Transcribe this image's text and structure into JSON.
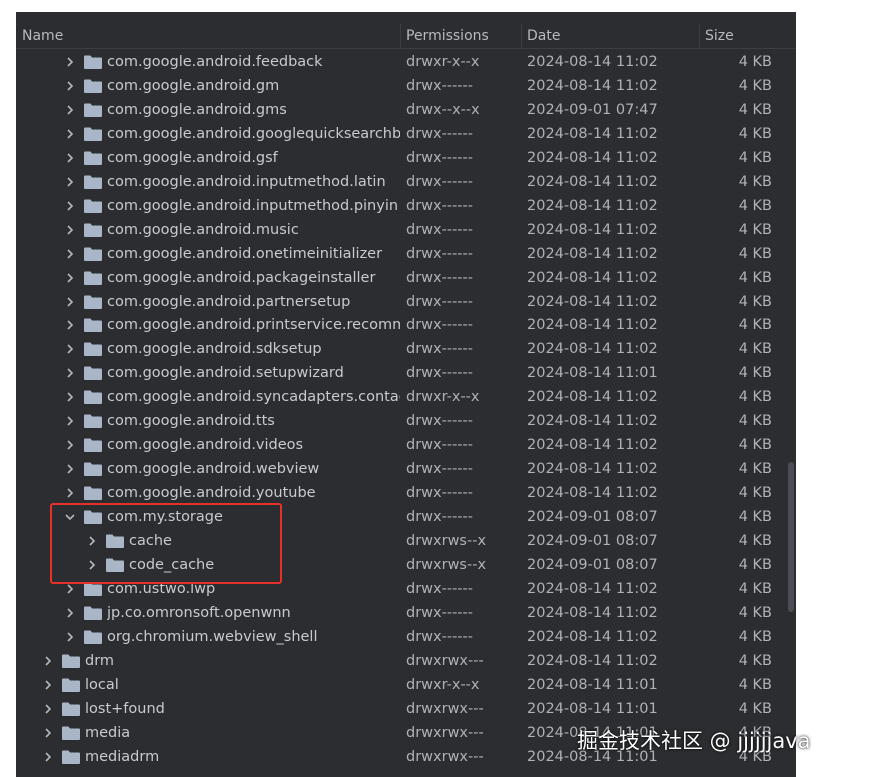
{
  "header": {
    "name": "Name",
    "permissions": "Permissions",
    "date": "Date",
    "size": "Size"
  },
  "icons": {
    "chevron_right": "chevron-right-icon",
    "chevron_down": "chevron-down-icon",
    "folder": "folder-icon"
  },
  "colors": {
    "panel_bg": "#2b2d30",
    "folder": "#a9b6c8",
    "highlight": "#e8302a"
  },
  "rows": [
    {
      "name": "com.google.android.feedback",
      "permissions": "drwxr-x--x",
      "date": "2024-08-14 11:02",
      "size": "4 KB",
      "level": 2,
      "expanded": false
    },
    {
      "name": "com.google.android.gm",
      "permissions": "drwx------",
      "date": "2024-08-14 11:02",
      "size": "4 KB",
      "level": 2,
      "expanded": false
    },
    {
      "name": "com.google.android.gms",
      "permissions": "drwx--x--x",
      "date": "2024-09-01 07:47",
      "size": "4 KB",
      "level": 2,
      "expanded": false
    },
    {
      "name": "com.google.android.googlequicksearchbox",
      "permissions": "drwx------",
      "date": "2024-08-14 11:02",
      "size": "4 KB",
      "level": 2,
      "expanded": false
    },
    {
      "name": "com.google.android.gsf",
      "permissions": "drwx------",
      "date": "2024-08-14 11:02",
      "size": "4 KB",
      "level": 2,
      "expanded": false
    },
    {
      "name": "com.google.android.inputmethod.latin",
      "permissions": "drwx------",
      "date": "2024-08-14 11:02",
      "size": "4 KB",
      "level": 2,
      "expanded": false
    },
    {
      "name": "com.google.android.inputmethod.pinyin",
      "permissions": "drwx------",
      "date": "2024-08-14 11:02",
      "size": "4 KB",
      "level": 2,
      "expanded": false
    },
    {
      "name": "com.google.android.music",
      "permissions": "drwx------",
      "date": "2024-08-14 11:02",
      "size": "4 KB",
      "level": 2,
      "expanded": false
    },
    {
      "name": "com.google.android.onetimeinitializer",
      "permissions": "drwx------",
      "date": "2024-08-14 11:02",
      "size": "4 KB",
      "level": 2,
      "expanded": false
    },
    {
      "name": "com.google.android.packageinstaller",
      "permissions": "drwx------",
      "date": "2024-08-14 11:02",
      "size": "4 KB",
      "level": 2,
      "expanded": false
    },
    {
      "name": "com.google.android.partnersetup",
      "permissions": "drwx------",
      "date": "2024-08-14 11:02",
      "size": "4 KB",
      "level": 2,
      "expanded": false
    },
    {
      "name": "com.google.android.printservice.recommendation",
      "permissions": "drwx------",
      "date": "2024-08-14 11:02",
      "size": "4 KB",
      "level": 2,
      "expanded": false
    },
    {
      "name": "com.google.android.sdksetup",
      "permissions": "drwx------",
      "date": "2024-08-14 11:02",
      "size": "4 KB",
      "level": 2,
      "expanded": false
    },
    {
      "name": "com.google.android.setupwizard",
      "permissions": "drwx------",
      "date": "2024-08-14 11:01",
      "size": "4 KB",
      "level": 2,
      "expanded": false
    },
    {
      "name": "com.google.android.syncadapters.contacts",
      "permissions": "drwxr-x--x",
      "date": "2024-08-14 11:02",
      "size": "4 KB",
      "level": 2,
      "expanded": false
    },
    {
      "name": "com.google.android.tts",
      "permissions": "drwx------",
      "date": "2024-08-14 11:02",
      "size": "4 KB",
      "level": 2,
      "expanded": false
    },
    {
      "name": "com.google.android.videos",
      "permissions": "drwx------",
      "date": "2024-08-14 11:02",
      "size": "4 KB",
      "level": 2,
      "expanded": false
    },
    {
      "name": "com.google.android.webview",
      "permissions": "drwx------",
      "date": "2024-08-14 11:02",
      "size": "4 KB",
      "level": 2,
      "expanded": false
    },
    {
      "name": "com.google.android.youtube",
      "permissions": "drwx------",
      "date": "2024-08-14 11:02",
      "size": "4 KB",
      "level": 2,
      "expanded": false
    },
    {
      "name": "com.my.storage",
      "permissions": "drwx------",
      "date": "2024-09-01 08:07",
      "size": "4 KB",
      "level": 2,
      "expanded": true
    },
    {
      "name": "cache",
      "permissions": "drwxrws--x",
      "date": "2024-09-01 08:07",
      "size": "4 KB",
      "level": 3,
      "expanded": false
    },
    {
      "name": "code_cache",
      "permissions": "drwxrws--x",
      "date": "2024-09-01 08:07",
      "size": "4 KB",
      "level": 3,
      "expanded": false
    },
    {
      "name": "com.ustwo.lwp",
      "permissions": "drwx------",
      "date": "2024-08-14 11:02",
      "size": "4 KB",
      "level": 2,
      "expanded": false
    },
    {
      "name": "jp.co.omronsoft.openwnn",
      "permissions": "drwx------",
      "date": "2024-08-14 11:02",
      "size": "4 KB",
      "level": 2,
      "expanded": false
    },
    {
      "name": "org.chromium.webview_shell",
      "permissions": "drwx------",
      "date": "2024-08-14 11:02",
      "size": "4 KB",
      "level": 2,
      "expanded": false
    },
    {
      "name": "drm",
      "permissions": "drwxrwx---",
      "date": "2024-08-14 11:02",
      "size": "4 KB",
      "level": 1,
      "expanded": false
    },
    {
      "name": "local",
      "permissions": "drwxr-x--x",
      "date": "2024-08-14 11:01",
      "size": "4 KB",
      "level": 1,
      "expanded": false
    },
    {
      "name": "lost+found",
      "permissions": "drwxrwx---",
      "date": "2024-08-14 11:01",
      "size": "4 KB",
      "level": 1,
      "expanded": false
    },
    {
      "name": "media",
      "permissions": "drwxrwx---",
      "date": "2024-08-14 11:01",
      "size": "4 KB",
      "level": 1,
      "expanded": false
    },
    {
      "name": "mediadrm",
      "permissions": "drwxrwx---",
      "date": "2024-08-14 11:01",
      "size": "4 KB",
      "level": 1,
      "expanded": false
    }
  ],
  "watermark": "掘金技术社区 @ jjjjjjava"
}
